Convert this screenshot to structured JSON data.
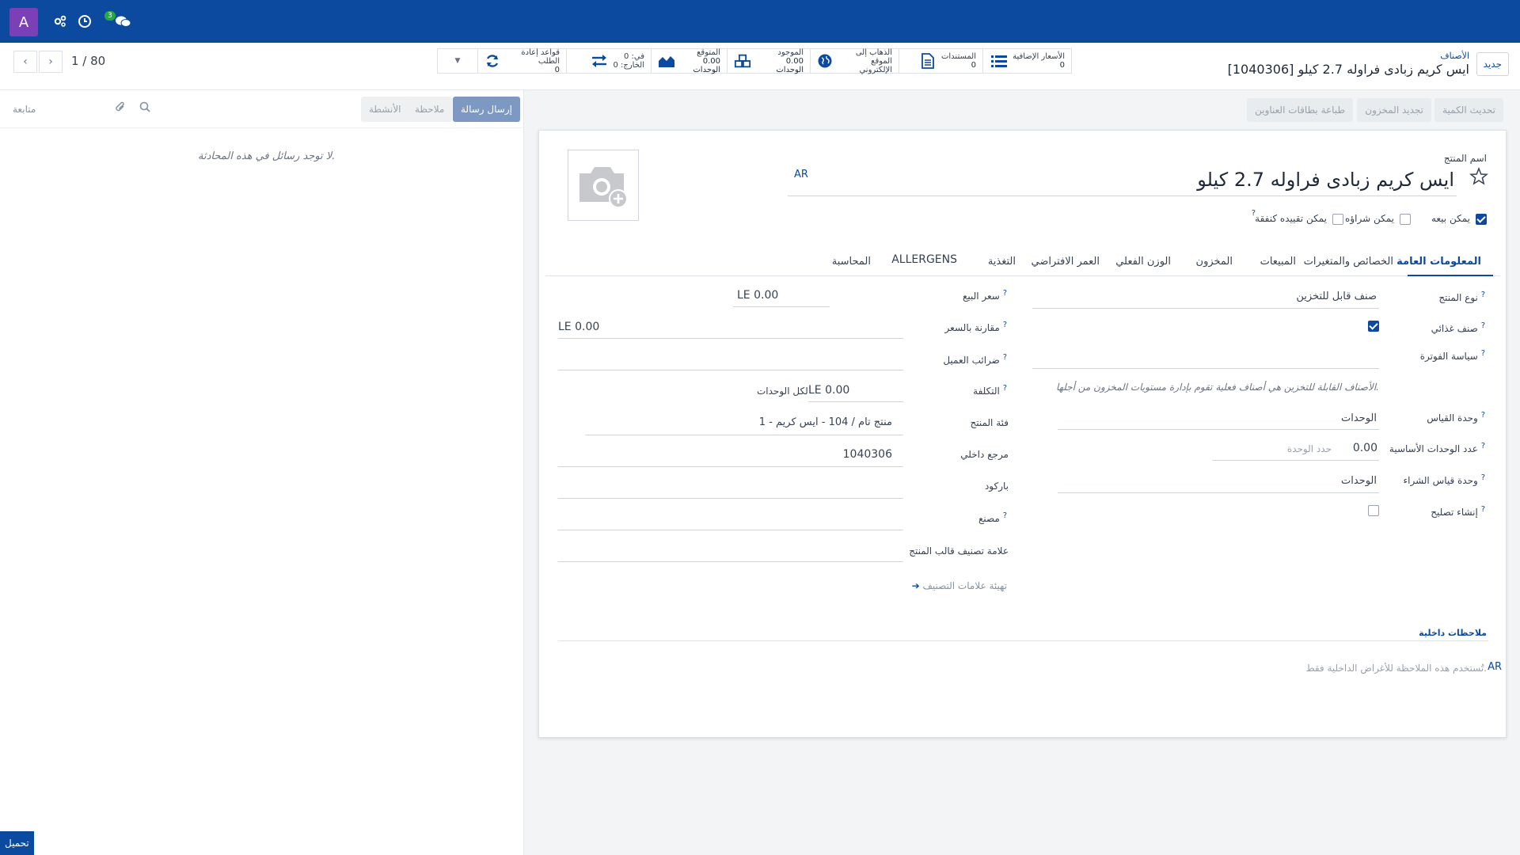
{
  "navbar": {
    "avatar_letter": "A",
    "messages_count": "3",
    "icons": [
      "settings-cog-icon",
      "clock-icon",
      "chat-icon"
    ]
  },
  "control_panel": {
    "new_button": "جديد",
    "breadcrumb_parent": "الأصناف",
    "breadcrumb_title": "[1040306] ايس كريم زبادى فراوله 2.7 كيلو",
    "pager": "1 / 80",
    "smart_buttons": [
      {
        "label": "الأسعار الإضافية",
        "value": "0",
        "icon": "list-icon"
      },
      {
        "label": "المستندات",
        "value": "0",
        "icon": "document-icon"
      },
      {
        "label": "الذهاب إلى",
        "label2": "الموقع الإلكتروني",
        "icon": "globe-icon"
      },
      {
        "label": "الموجود",
        "value": "0.00 الوحدات",
        "icon": "cubes-icon"
      },
      {
        "label": "المتوقع",
        "value": "0.00 الوحدات",
        "icon": "area-chart-icon"
      },
      {
        "label": "في: 0",
        "label2": "الخارج: 0",
        "icon": "exchange-icon"
      },
      {
        "label": "قواعد إعادة الطلب",
        "value": "0",
        "icon": "refresh-icon"
      }
    ]
  },
  "actions": {
    "update_qty": "تحديث الكمية",
    "replenish": "تجديد المخزون",
    "print_labels": "طباعة بطاقات العناوين"
  },
  "chatter": {
    "send_message": "إرسال رسالة",
    "log_note": "ملاحظة",
    "activities": "الأنشطة",
    "follow": "متابعة",
    "no_messages": "لا توجد رسائل في هذه المحادثة.",
    "upload": "تحميل"
  },
  "form": {
    "name_label": "اسم المنتج",
    "name_value": "ايس كريم  زبادى فراوله 2.7 كيلو",
    "lang_tag": "AR",
    "checkboxes": [
      {
        "label": "يمكن بيعه",
        "checked": true
      },
      {
        "label": "يمكن شراؤه",
        "checked": false
      },
      {
        "label": "يمكن تقييده كنفقة",
        "checked": false
      }
    ],
    "tabs": [
      "المعلومات العامة",
      "الخصائص والمتغيرات",
      "المبيعات",
      "المخزون",
      "الوزن الفعلي",
      "العمر الافتراضي",
      "التغذية",
      "ALLERGENS",
      "المحاسبة"
    ],
    "right_fields": {
      "product_type_label": "نوع المنتج",
      "product_type_value": "صنف قابل للتخزين",
      "food_item_label": "صنف غذائي",
      "invoice_policy_label": "سياسة الفوترة",
      "storable_hint": "الأصناف القابلة للتخزين هي أصناف فعلية تقوم بإدارة مستويات المخزون من أجلها.",
      "uom_label": "وحدة القياس",
      "uom_value": "الوحدات",
      "base_units_label": "عدد الوحدات الأساسية",
      "base_units_value": "0.00",
      "unit_limit_placeholder": "حدد الوحدة",
      "purchase_uom_label": "وحدة قياس الشراء",
      "purchase_uom_value": "الوحدات",
      "create_repair_label": "إنشاء تصليح"
    },
    "left_fields": {
      "sales_price_label": "سعر البيع",
      "sales_price_value": "LE 0.00",
      "compare_price_label": "مقارنة بالسعر",
      "compare_price_value": "LE 0.00",
      "customer_taxes_label": "ضرائب العميل",
      "cost_label": "التكلفة",
      "cost_value": "LE 0.00",
      "cost_suffix": "لكل الوحدات",
      "category_label": "فئة المنتج",
      "category_value": "1 - منتج تام / 104 - ايس كريم",
      "internal_ref_label": "مرجع داخلي",
      "internal_ref_value": "1040306",
      "barcode_label": "باركود",
      "factory_label": "مصنع",
      "template_tag_label": "علامة تصنيف قالب المنتج",
      "configure_tags": "تهيئة علامات التصنيف"
    },
    "internal_notes_title": "ملاحظات داخلية",
    "internal_notes_placeholder": "تُستخدم هذه الملاحظة للأغراض الداخلية فقط.",
    "internal_notes_lang": "AR"
  },
  "colors": {
    "navbar": "#0b4a9e",
    "avatar": "#7b3fb8",
    "badge": "#28a745",
    "accent": "#0b4a9e"
  }
}
